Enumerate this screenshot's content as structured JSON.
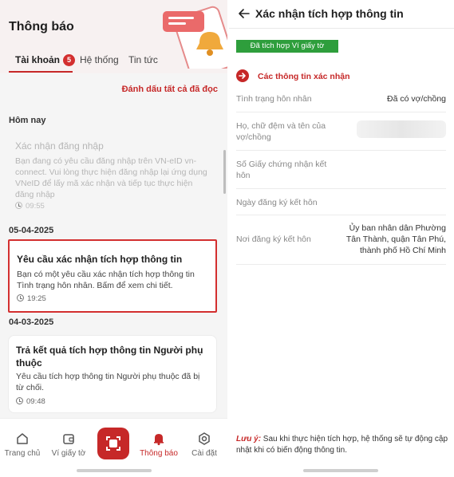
{
  "left": {
    "title": "Thông báo",
    "tabs": [
      {
        "label": "Tài khoản",
        "badge": "5",
        "active": true
      },
      {
        "label": "Hệ thống",
        "active": false
      },
      {
        "label": "Tin tức",
        "active": false
      }
    ],
    "mark_all_read": "Đánh dấu tất cả đã đọc",
    "sections": {
      "today": "Hôm nay",
      "date1": "05-04-2025",
      "date2": "04-03-2025"
    },
    "notifications": [
      {
        "title": "Xác nhận đăng nhập",
        "body": "Bạn đang có yêu cầu đăng nhập trên VN-eID vn-connect. Vui lòng thực hiện đăng nhập lại ứng dụng VNeID để lấy mã xác nhận và tiếp tục thực hiện đăng nhập",
        "time": "09:55",
        "read": true
      },
      {
        "title": "Yêu cầu xác nhận tích hợp thông tin",
        "body": "Bạn có một yêu cầu xác nhận tích hợp thông tin Tình trạng hôn nhân. Bấm để xem chi tiết.",
        "time": "19:25",
        "highlighted": true
      },
      {
        "title": "Trả kết quả tích hợp thông tin Người phụ thuộc",
        "body": "Yêu cầu tích hợp thông tin Người phụ thuộc đã bị từ chối.",
        "time": "09:48"
      }
    ],
    "nav": [
      {
        "label": "Trang chủ",
        "icon": "home-icon"
      },
      {
        "label": "Ví giấy tờ",
        "icon": "wallet-icon"
      },
      {
        "label": "",
        "icon": "scan-icon"
      },
      {
        "label": "Thông báo",
        "icon": "bell-icon",
        "active": true
      },
      {
        "label": "Cài đặt",
        "icon": "gear-icon"
      }
    ]
  },
  "right": {
    "title": "Xác nhận tích hợp thông tin",
    "verified_badge": "Đã tích hợp Ví giấy tờ",
    "section_heading": "Các thông tin xác nhận",
    "rows": [
      {
        "label": "Tình trạng hôn nhân",
        "value": "Đã có vợ/chồng"
      },
      {
        "label": "Họ, chữ đệm và tên của vợ/chồng",
        "value": ""
      },
      {
        "label": "Số Giấy chứng nhận kết hôn",
        "value": ""
      },
      {
        "label": "Ngày đăng ký kết hôn",
        "value": ""
      },
      {
        "label": "Nơi đăng ký kết hôn",
        "value": "Ủy ban nhân dân Phường Tân Thành, quận Tân Phú, thành phố Hồ Chí Minh"
      }
    ],
    "note_label": "Lưu ý:",
    "note_text": " Sau khi thực hiện tích hợp, hệ thống sẽ tự động cập nhật khi có biến động thông tin."
  },
  "colors": {
    "accent": "#c62828",
    "success": "#2e9e3c",
    "muted_text": "#888888"
  }
}
